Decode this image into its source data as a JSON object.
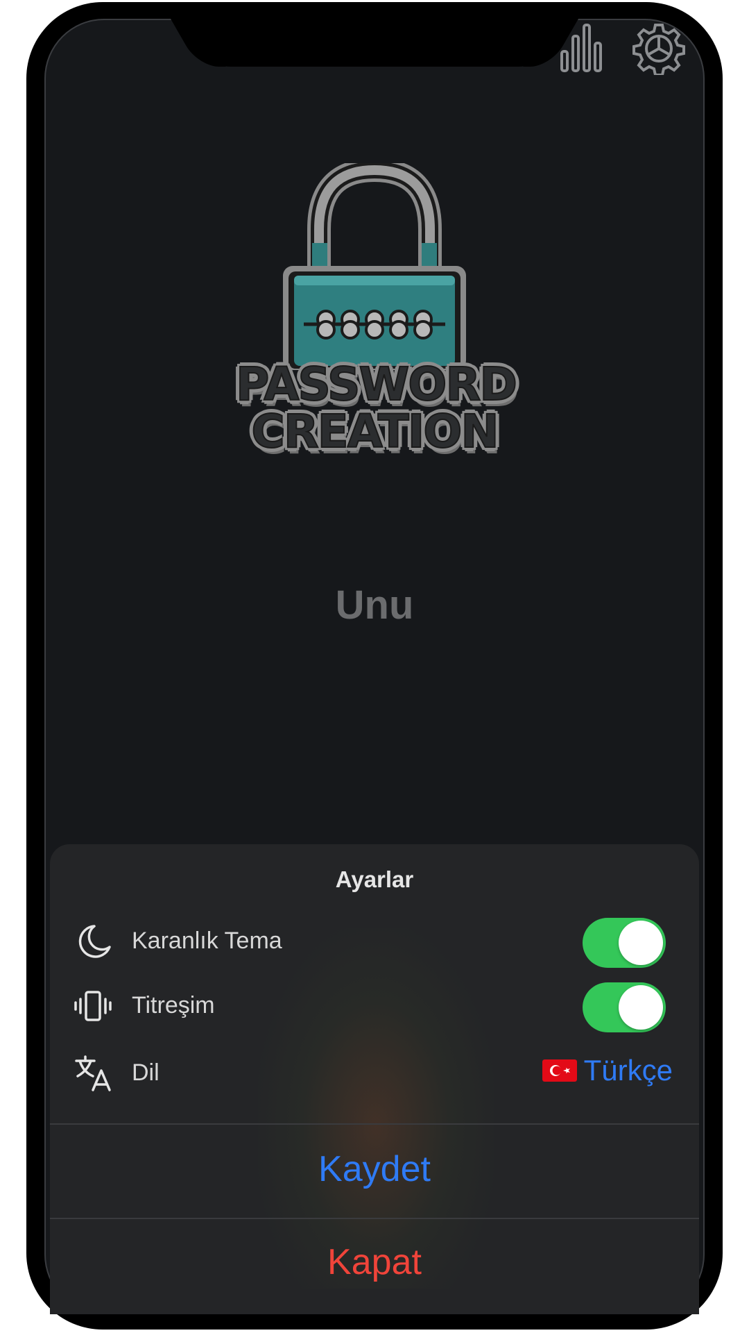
{
  "header": {
    "stats_icon": "bar-chart-icon",
    "settings_icon": "gear-icon"
  },
  "logo": {
    "line1": "PASSWORD",
    "line2": "CREATION"
  },
  "main": {
    "title": "Unu"
  },
  "settings_sheet": {
    "title": "Ayarlar",
    "rows": [
      {
        "icon": "moon-icon",
        "label": "Karanlık Tema",
        "control": "toggle",
        "on": true
      },
      {
        "icon": "vibration-icon",
        "label": "Titreşim",
        "control": "toggle",
        "on": true
      },
      {
        "icon": "translate-icon",
        "label": "Dil",
        "control": "select",
        "value": "Türkçe",
        "flag": "turkey-flag"
      }
    ],
    "save_label": "Kaydet",
    "close_label": "Kapat"
  },
  "colors": {
    "background": "#16181b",
    "sheet": "#242527",
    "accent_blue": "#2f7bf5",
    "destructive_red": "#f0443a",
    "toggle_on": "#34c759"
  }
}
